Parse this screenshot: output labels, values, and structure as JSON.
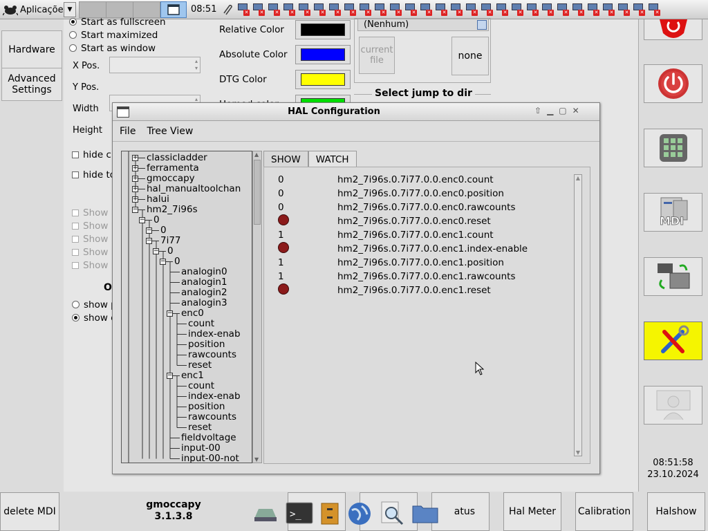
{
  "topbar": {
    "app_menu_label": "Aplicaçõe",
    "clock": "08:51",
    "tray_icon_count": 28
  },
  "left_sidebar": {
    "hardware_label": "Hardware",
    "advanced_label": "Advanced Settings"
  },
  "settings": {
    "window_options": [
      {
        "label": "Start as fullscreen",
        "selected": true
      },
      {
        "label": "Start maximized",
        "selected": false
      },
      {
        "label": "Start as window",
        "selected": false
      }
    ],
    "xpos_label": "X Pos.",
    "ypos_label": "Y Pos.",
    "width_label": "Width",
    "height_label": "Height",
    "hide_cursor_label": "hide cu",
    "hide_tooltip_label": "hide to",
    "show_keyboard_items": [
      "Show k",
      "Show k",
      "Show k",
      "Show k",
      "Show k"
    ],
    "o_section_label": "O",
    "show_radios": [
      {
        "label": "show p",
        "selected": false
      },
      {
        "label": "show c",
        "selected": true
      }
    ],
    "color_rows": [
      {
        "label": "Relative Color",
        "color": "#000000"
      },
      {
        "label": "Absolute Color",
        "color": "#0000ff"
      },
      {
        "label": "DTG Color",
        "color": "#ffff00"
      },
      {
        "label": "Homed color",
        "color": "#00e000"
      }
    ],
    "file_combo_value": "(Nenhum)",
    "current_file_label": "current file",
    "none_label": "none",
    "jump_dir_label": "Select jump to dir"
  },
  "hal": {
    "title": "HAL Configuration",
    "menu_file": "File",
    "menu_tree": "Tree View",
    "tab_show": "SHOW",
    "tab_watch": "WATCH",
    "tree": [
      {
        "label": "classicladder",
        "depth": 0,
        "exp": "+"
      },
      {
        "label": "ferramenta",
        "depth": 0,
        "exp": "+"
      },
      {
        "label": "gmoccapy",
        "depth": 0,
        "exp": "+"
      },
      {
        "label": "hal_manualtoolchan",
        "depth": 0,
        "exp": "+"
      },
      {
        "label": "halui",
        "depth": 0,
        "exp": "+"
      },
      {
        "label": "hm2_7i96s",
        "depth": 0,
        "exp": "-"
      },
      {
        "label": "0",
        "depth": 1,
        "exp": "-"
      },
      {
        "label": "0",
        "depth": 2,
        "exp": "-"
      },
      {
        "label": "7i77",
        "depth": 2,
        "exp": "-"
      },
      {
        "label": "0",
        "depth": 3,
        "exp": "-"
      },
      {
        "label": "0",
        "depth": 4,
        "exp": "-"
      },
      {
        "label": "analogin0",
        "depth": 5,
        "exp": ""
      },
      {
        "label": "analogin1",
        "depth": 5,
        "exp": ""
      },
      {
        "label": "analogin2",
        "depth": 5,
        "exp": ""
      },
      {
        "label": "analogin3",
        "depth": 5,
        "exp": ""
      },
      {
        "label": "enc0",
        "depth": 5,
        "exp": "-"
      },
      {
        "label": "count",
        "depth": 6,
        "exp": ""
      },
      {
        "label": "index-enab",
        "depth": 6,
        "exp": ""
      },
      {
        "label": "position",
        "depth": 6,
        "exp": ""
      },
      {
        "label": "rawcounts",
        "depth": 6,
        "exp": ""
      },
      {
        "label": "reset",
        "depth": 6,
        "exp": ""
      },
      {
        "label": "enc1",
        "depth": 5,
        "exp": "-"
      },
      {
        "label": "count",
        "depth": 6,
        "exp": ""
      },
      {
        "label": "index-enab",
        "depth": 6,
        "exp": ""
      },
      {
        "label": "position",
        "depth": 6,
        "exp": ""
      },
      {
        "label": "rawcounts",
        "depth": 6,
        "exp": ""
      },
      {
        "label": "reset",
        "depth": 6,
        "exp": ""
      },
      {
        "label": "fieldvoltage",
        "depth": 5,
        "exp": ""
      },
      {
        "label": "input-00",
        "depth": 5,
        "exp": ""
      },
      {
        "label": "input-00-not",
        "depth": 5,
        "exp": ""
      }
    ],
    "watch": [
      {
        "value": "0",
        "led": false,
        "name": "hm2_7i96s.0.7i77.0.0.enc0.count"
      },
      {
        "value": "0",
        "led": false,
        "name": "hm2_7i96s.0.7i77.0.0.enc0.position"
      },
      {
        "value": "0",
        "led": false,
        "name": "hm2_7i96s.0.7i77.0.0.enc0.rawcounts"
      },
      {
        "value": "",
        "led": true,
        "name": "hm2_7i96s.0.7i77.0.0.enc0.reset"
      },
      {
        "value": "1",
        "led": false,
        "name": "hm2_7i96s.0.7i77.0.0.enc1.count"
      },
      {
        "value": "",
        "led": true,
        "name": "hm2_7i96s.0.7i77.0.0.enc1.index-enable"
      },
      {
        "value": "1",
        "led": false,
        "name": "hm2_7i96s.0.7i77.0.0.enc1.position"
      },
      {
        "value": "1",
        "led": false,
        "name": "hm2_7i96s.0.7i77.0.0.enc1.rawcounts"
      },
      {
        "value": "",
        "led": true,
        "name": "hm2_7i96s.0.7i77.0.0.enc1.reset"
      }
    ]
  },
  "right_sidebar": {
    "clock_time": "08:51:58",
    "clock_date": "23.10.2024",
    "mdi_label": "MDI"
  },
  "bottom": {
    "delete_mdi": "delete MDI",
    "app_name": "gmoccapy",
    "app_version": "3.1.3.8",
    "status_partial": "atus",
    "hal_meter": "Hal Meter",
    "calibration": "Calibration",
    "halshow": "Halshow"
  },
  "colors": {
    "accent_yellow": "#f5f500",
    "led_red": "#8b1a1a"
  }
}
